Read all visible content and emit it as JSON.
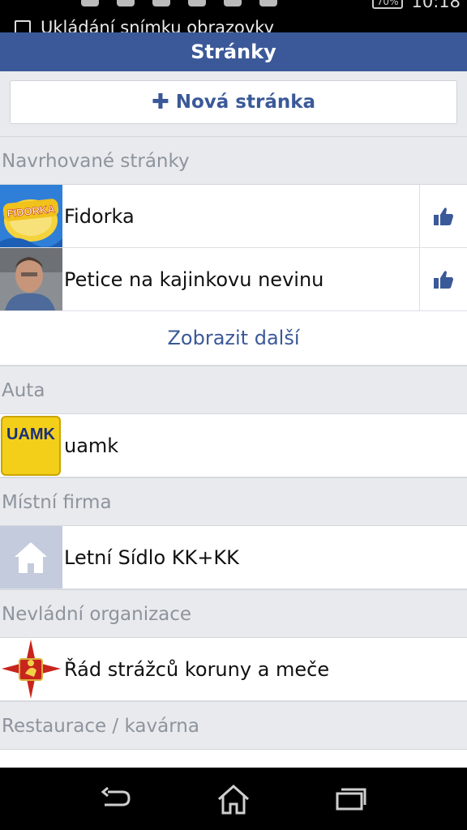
{
  "status_bar": {
    "notification_text": "Ukládání snímku obrazovky",
    "battery": "70%",
    "time": "10:18"
  },
  "header": {
    "title": "Stránky"
  },
  "new_page_button": {
    "label": "Nová stránka",
    "icon": "plus-icon"
  },
  "suggested": {
    "header": "Navrhované stránky",
    "items": [
      {
        "name": "Fidorka",
        "thumb_text": "FIDORKA",
        "action_icon": "thumbs-up-icon"
      },
      {
        "name": "Petice na kajinkovu nevinu",
        "action_icon": "thumbs-up-icon"
      }
    ],
    "more_label": "Zobrazit další"
  },
  "categories": [
    {
      "header": "Auta",
      "items": [
        {
          "name": "uamk",
          "thumb_text": "UAMK"
        }
      ]
    },
    {
      "header": "Místní firma",
      "items": [
        {
          "name": "Letní Sídlo KK+KK",
          "thumb_icon": "house-icon"
        }
      ]
    },
    {
      "header": "Nevládní organizace",
      "items": [
        {
          "name": "Řád strážců koruny a meče"
        }
      ]
    },
    {
      "header": "Restaurace / kavárna",
      "items": []
    }
  ],
  "navigation": [
    "back-icon",
    "home-icon",
    "recent-apps-icon"
  ],
  "colors": {
    "brand": "#3b5998",
    "section_bg": "#e9eaed",
    "section_text": "#8d949e"
  }
}
